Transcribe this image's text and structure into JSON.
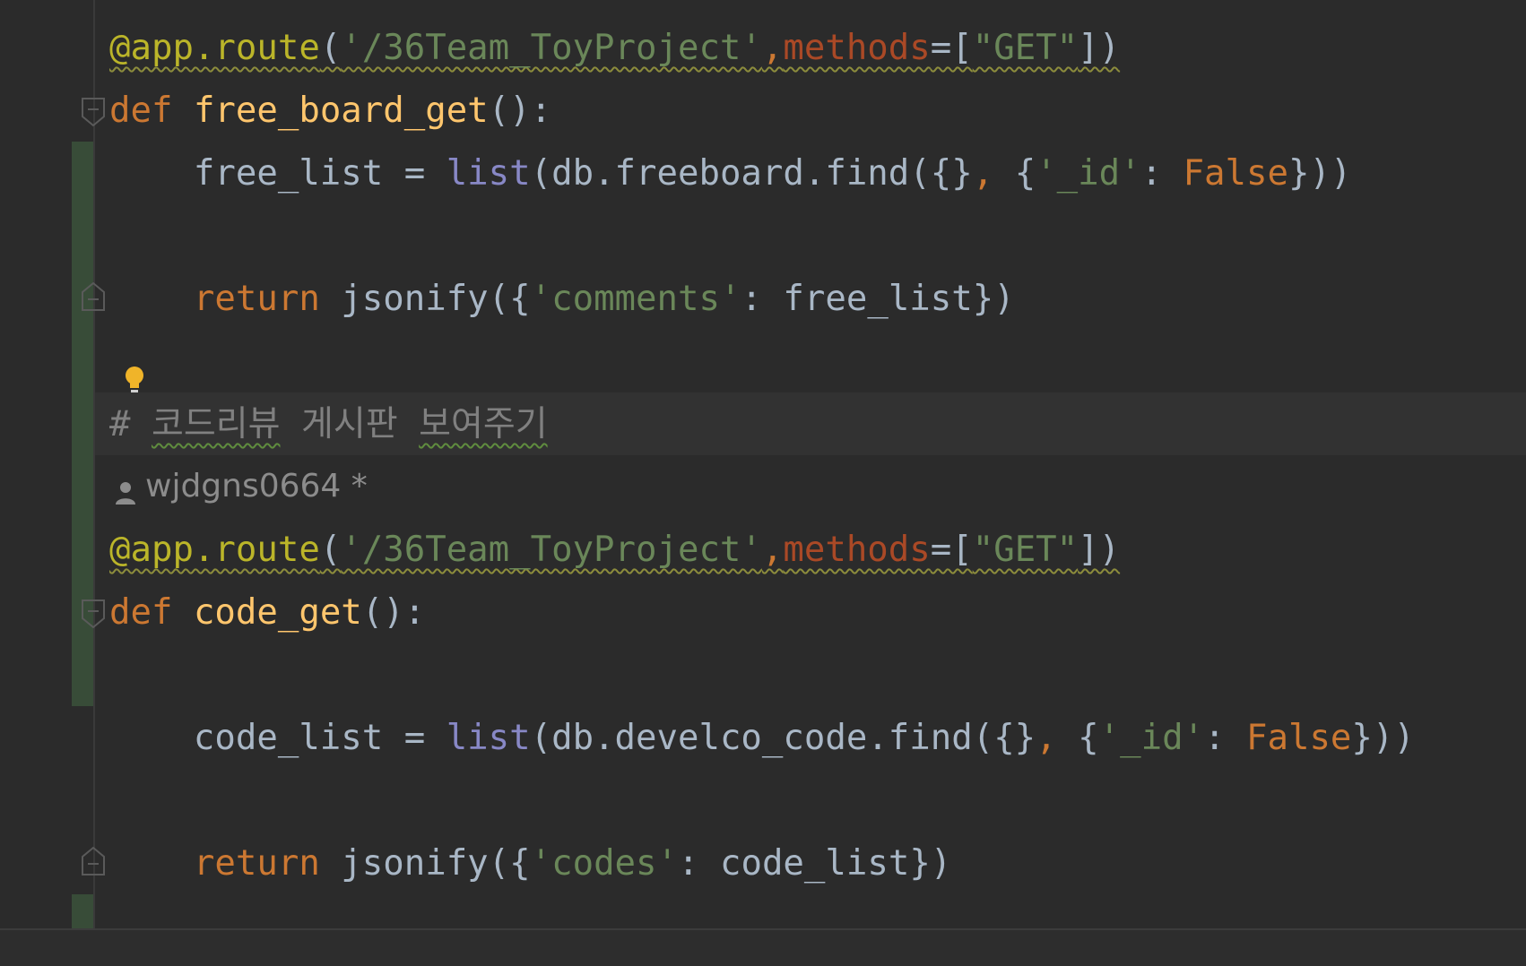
{
  "editor": {
    "comment": {
      "hash": "# ",
      "word1": "코드리뷰",
      "word2": "게시판",
      "word3": "보여주기"
    },
    "author": {
      "name": "wjdgns0664",
      "modified_mark": " *"
    },
    "tokens": {
      "decorator": "@app.route",
      "route_path": "'/36Team_ToyProject'",
      "methods_kw": "methods",
      "get_method": "\"GET\"",
      "def_kw": "def",
      "return_kw": "return",
      "list_fn": "list",
      "jsonify_fn": "jsonify",
      "false_kw": "False",
      "id_key": "'_id'"
    },
    "functions": [
      {
        "name": "free_board_get",
        "var": "free_list",
        "collection": "db.freeboard.find",
        "return_key": "'comments'"
      },
      {
        "name": "code_get",
        "var": "code_list",
        "collection": "db.develco_code.find",
        "return_key": "'codes'"
      }
    ]
  },
  "colors": {
    "background": "#2b2b2b",
    "keyword": "#cc7832",
    "function_name": "#ffc66d",
    "string": "#6a8759",
    "builtin": "#8888c6",
    "parameter": "#aa4926",
    "decorator": "#bbb529",
    "comment": "#808080",
    "text": "#a9b7c6"
  },
  "icons": {
    "bulb": "lightbulb-icon",
    "author": "person-icon",
    "fold": "fold-icon"
  }
}
